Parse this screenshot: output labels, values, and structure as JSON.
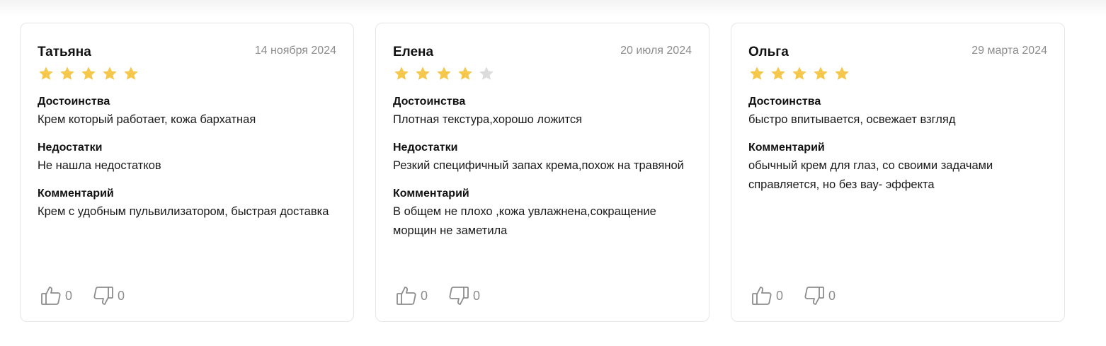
{
  "reviews": [
    {
      "author": "Татьяна",
      "date": "14 ноября 2024",
      "rating": 5,
      "sections": [
        {
          "title": "Достоинства",
          "text": "Крем который работает, кожа бархатная"
        },
        {
          "title": "Недостатки",
          "text": "Не нашла недостатков"
        },
        {
          "title": "Комментарий",
          "text": "Крем с удобным пульвилизатором, быстрая доставка"
        }
      ],
      "likes": "0",
      "dislikes": "0"
    },
    {
      "author": "Елена",
      "date": "20 июля 2024",
      "rating": 4,
      "sections": [
        {
          "title": "Достоинства",
          "text": "Плотная текстура,хорошо ложится"
        },
        {
          "title": "Недостатки",
          "text": "Резкий специфичный запах крема,похож на травяной"
        },
        {
          "title": "Комментарий",
          "text": "В общем не плохо ,кожа увлажнена,сокращение морщин не заметила"
        }
      ],
      "likes": "0",
      "dislikes": "0"
    },
    {
      "author": "Ольга",
      "date": "29 марта 2024",
      "rating": 5,
      "sections": [
        {
          "title": "Достоинства",
          "text": "быстро впитывается, освежает взгляд"
        },
        {
          "title": "Комментарий",
          "text": "обычный крем для глаз, со своими задачами справляется, но без вау- эффекта"
        }
      ],
      "likes": "0",
      "dislikes": "0"
    }
  ],
  "colors": {
    "star_filled": "#f5c84c",
    "star_empty": "#dcdcdc",
    "vote_icon": "#8c8c8c"
  },
  "icons": {
    "like": "thumbs-up-icon",
    "dislike": "thumbs-down-icon",
    "star": "star-icon"
  }
}
